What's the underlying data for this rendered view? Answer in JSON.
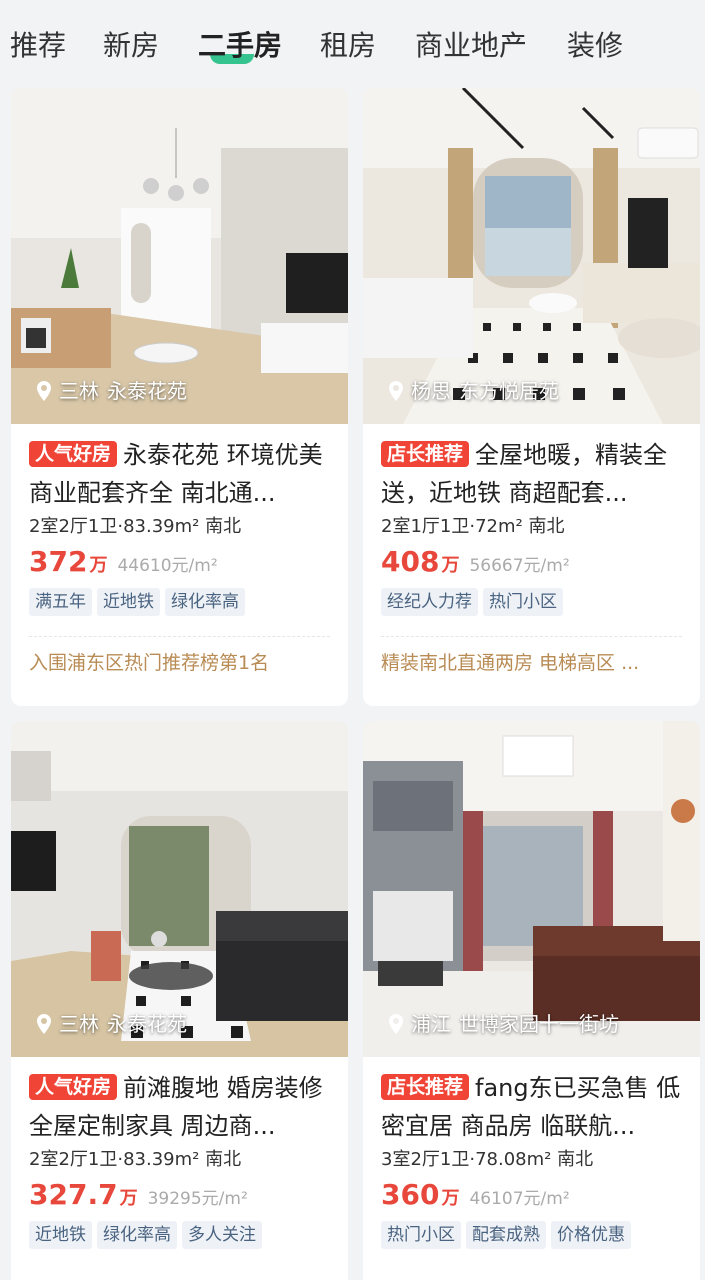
{
  "tabs": [
    "推荐",
    "新房",
    "二手房",
    "租房",
    "商业地产",
    "装修"
  ],
  "active_tab_index": 2,
  "listings": [
    {
      "district": "三林",
      "community": "永泰花苑",
      "badge": "人气好房",
      "badge_color": "#f04436",
      "title": "永泰花苑 环境优美 商业配套齐全 南北通...",
      "attrs": "2室2厅1卫·83.39m² 南北",
      "price": "372",
      "price_unit": "万",
      "unit_price": "44610元/m²",
      "tags": [
        "满五年",
        "近地铁",
        "绿化率高"
      ],
      "recommend": "入围浦东区热门推荐榜第1名"
    },
    {
      "district": "杨思",
      "community": "东方悦居苑",
      "badge": "店长推荐",
      "badge_color": "#f04436",
      "title": "全屋地暖，精装全送，近地铁 商超配套...",
      "attrs": "2室1厅1卫·72m² 南北",
      "price": "408",
      "price_unit": "万",
      "unit_price": "56667元/m²",
      "tags": [
        "经纪人力荐",
        "热门小区"
      ],
      "recommend": "精装南北直通两房 电梯高区 ..."
    },
    {
      "district": "三林",
      "community": "永泰花苑",
      "badge": "人气好房",
      "badge_color": "#f04436",
      "title": "前滩腹地 婚房装修 全屋定制家具 周边商...",
      "attrs": "2室2厅1卫·83.39m² 南北",
      "price": "327.7",
      "price_unit": "万",
      "unit_price": "39295元/m²",
      "tags": [
        "近地铁",
        "绿化率高",
        "多人关注"
      ],
      "recommend": ""
    },
    {
      "district": "浦江",
      "community": "世博家园十一街坊",
      "badge": "店长推荐",
      "badge_color": "#f04436",
      "title": "fang东已买急售 低密宜居 商品房 临联航...",
      "attrs": "3室2厅1卫·78.08m² 南北",
      "price": "360",
      "price_unit": "万",
      "unit_price": "46107元/m²",
      "tags": [
        "热门小区",
        "配套成熟",
        "价格优惠"
      ],
      "recommend": ""
    }
  ],
  "colors": {
    "accent_green": "#35c48f",
    "price_red": "#e8483b",
    "tag_bg": "#eef2f7",
    "tag_text": "#4a6380",
    "recommend_text": "#b98c55"
  }
}
